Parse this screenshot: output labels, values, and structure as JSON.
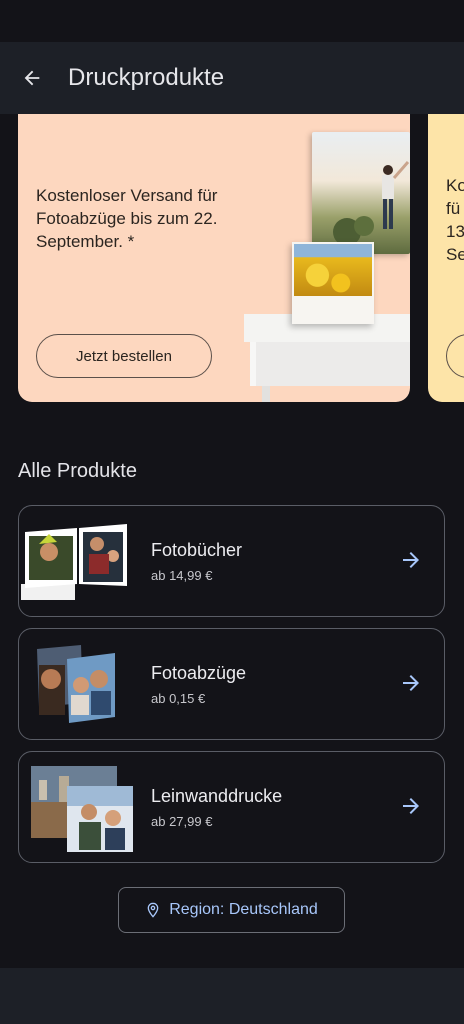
{
  "header": {
    "title": "Druckprodukte"
  },
  "promo": {
    "text": "Kostenloser Versand für Fotoabzüge bis zum 22. September. *",
    "button_label": "Jetzt bestellen"
  },
  "promo2": {
    "text": "Ko\nfü\n13.\nSe"
  },
  "section": {
    "title": "Alle Produkte"
  },
  "products": [
    {
      "name": "Fotobücher",
      "price": "ab 14,99 €"
    },
    {
      "name": "Fotoabzüge",
      "price": "ab 0,15 €"
    },
    {
      "name": "Leinwanddrucke",
      "price": "ab 27,99 €"
    }
  ],
  "region": {
    "label": "Region: Deutschland"
  },
  "colors": {
    "accent": "#a8c7fa",
    "promo_bg": "#fdd7bf",
    "promo2_bg": "#fde4a8",
    "background": "#131318"
  }
}
